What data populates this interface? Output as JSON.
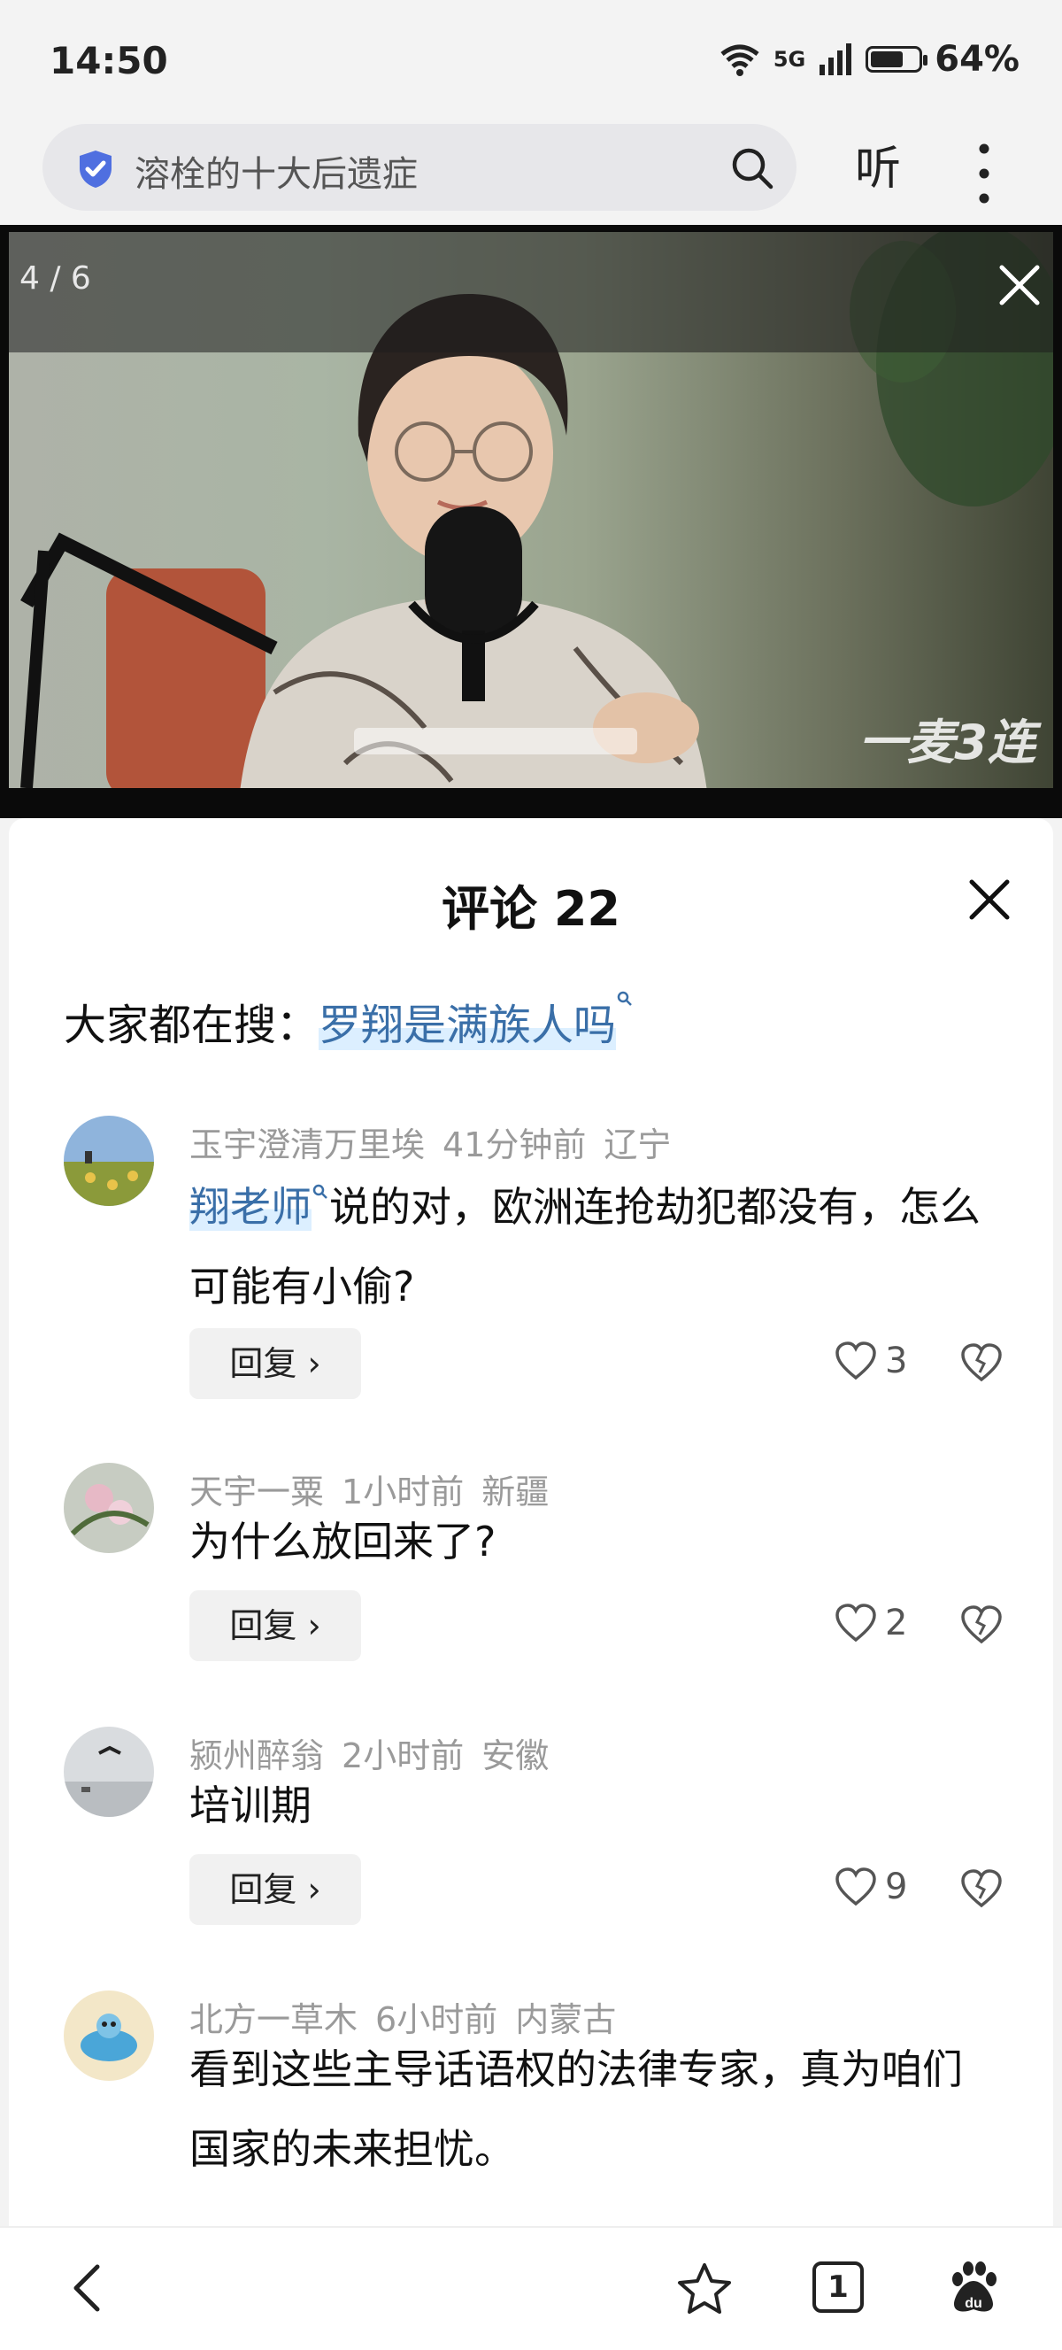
{
  "status_bar": {
    "time": "14:50",
    "network": "5G",
    "battery": "64%",
    "battery_level": 0.64
  },
  "search": {
    "query": "溶栓的十大后遗症",
    "listen_label": "听"
  },
  "viewer": {
    "page_counter": "4 / 6",
    "watermark": "一麦3连"
  },
  "comments": {
    "title": "评论 22",
    "suggest_label": "大家都在搜：",
    "suggest_keyword": "罗翔是满族人吗",
    "reply_label": "回复 ›",
    "items": [
      {
        "user": "玉宇澄清万里埃",
        "time": "41分钟前",
        "region": "辽宁",
        "mention": "翔老师",
        "text": "说的对，欧洲连抢劫犯都没有，怎么可能有小偷?",
        "likes": "3"
      },
      {
        "user": "天宇一粟",
        "time": "1小时前",
        "region": "新疆",
        "text": "为什么放回来了?",
        "likes": "2"
      },
      {
        "user": "颍州醉翁",
        "time": "2小时前",
        "region": "安徽",
        "text": "培训期",
        "likes": "9"
      },
      {
        "user": "北方一草木",
        "time": "6小时前",
        "region": "内蒙古",
        "text": "看到这些主导话语权的法律专家，真为咱们国家的未来担忧。"
      }
    ]
  },
  "bottom_nav": {
    "tab_count": "1"
  },
  "icons": [
    "shield-icon",
    "search-icon",
    "more-icon",
    "close-icon",
    "heart-icon",
    "broken-heart-icon",
    "back-icon",
    "star-icon",
    "tabs-icon",
    "baidu-paw-icon"
  ]
}
